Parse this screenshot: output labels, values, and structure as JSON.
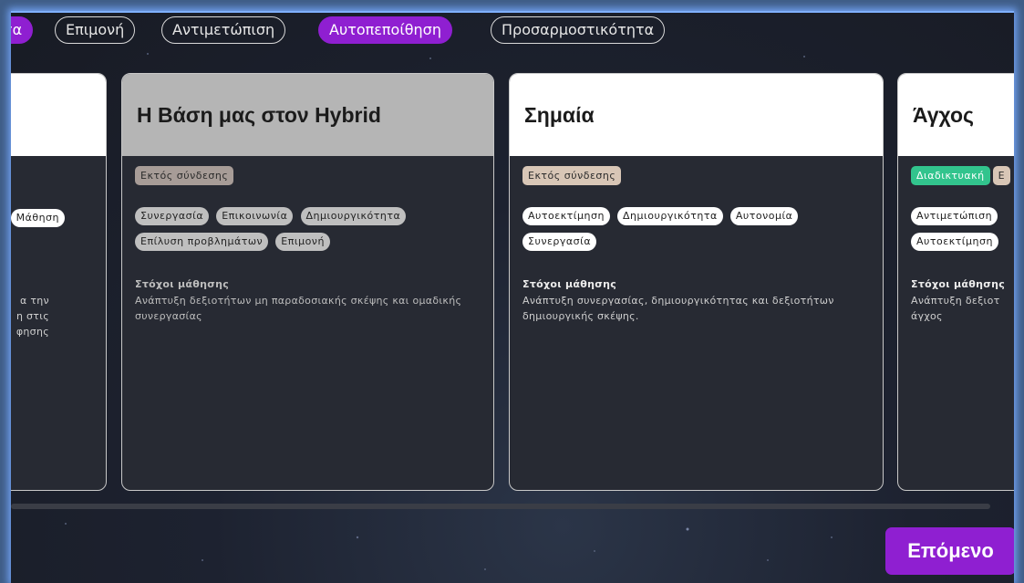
{
  "filters": [
    {
      "label": "τα",
      "active": true
    },
    {
      "label": "Επιμονή",
      "active": false
    },
    {
      "label": "Αντιμετώπιση",
      "active": false
    },
    {
      "label": "Αυτοπεποίθηση",
      "active": true
    },
    {
      "label": "Προσαρμοστικότητα",
      "active": false
    }
  ],
  "cards": [
    {
      "title": "",
      "tags": [
        "Μάθηση"
      ],
      "goals_text_lines": [
        "α την",
        "η στις",
        "φησης"
      ]
    },
    {
      "title": "Η Βάση μας στον Hybrid",
      "mode": "Εκτός σύνδεσης",
      "tags": [
        "Συνεργασία",
        "Επικοινωνία",
        "Δημιουργικότητα",
        "Επίλυση προβλημάτων",
        "Επιμονή"
      ],
      "goals_label": "Στόχοι μάθησης",
      "goals_text": "Ανάπτυξη δεξιοτήτων μη παραδοσιακής σκέψης και ομαδικής συνεργασίας"
    },
    {
      "title": "Σημαία",
      "mode": "Εκτός σύνδεσης",
      "tags": [
        "Αυτοεκτίμηση",
        "Δημιουργικότητα",
        "Αυτονομία",
        "Συνεργασία"
      ],
      "goals_label": "Στόχοι μάθησης",
      "goals_text": "Ανάπτυξη συνεργασίας, δημιουργικότητας και δεξιοτήτων δημιουργικής σκέψης."
    },
    {
      "title": "Άγχος",
      "mode_online": "Διαδικτυακή",
      "mode_offline": "Ε",
      "tags": [
        "Αντιμετώπιση",
        "Αυτοεκτίμηση"
      ],
      "goals_label": "Στόχοι μάθησης",
      "goals_text": "Ανάπτυξη δεξιοτ άγχος"
    }
  ],
  "next_button": "Επόμενο",
  "colors": {
    "accent": "#8f1fd1",
    "online_badge": "#32c48d",
    "background": "#1d2230"
  }
}
